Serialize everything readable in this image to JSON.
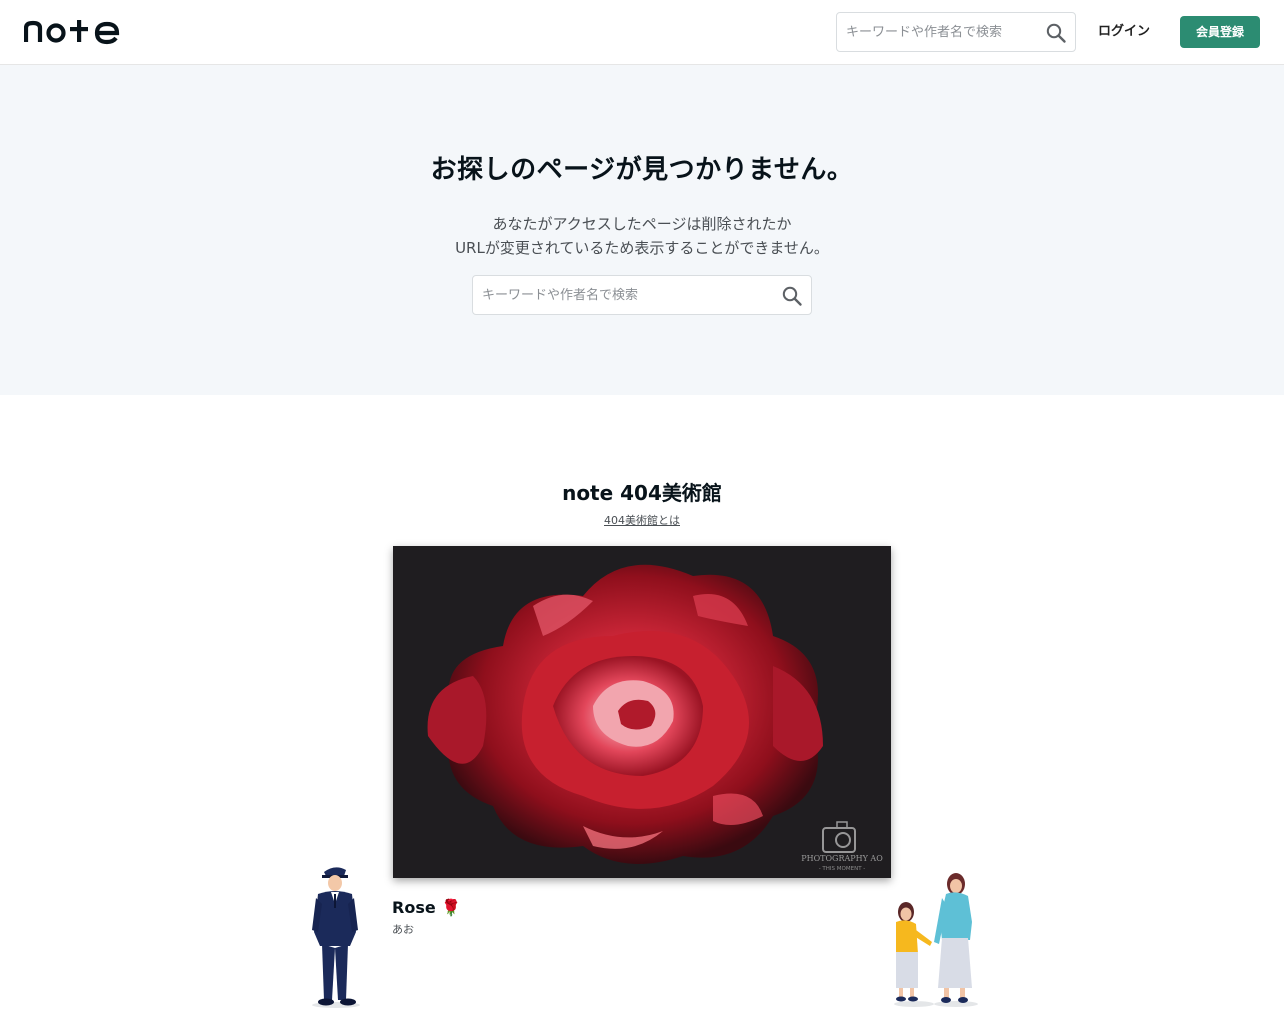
{
  "header": {
    "logo_text": "note",
    "search_placeholder": "キーワードや作者名で検索",
    "login_label": "ログイン",
    "signup_label": "会員登録"
  },
  "hero": {
    "title": "お探しのページが見つかりません。",
    "description_line1": "あなたがアクセスしたページは削除されたか",
    "description_line2": "URLが変更されているため表示することができません。",
    "search_placeholder": "キーワードや作者名で検索"
  },
  "museum": {
    "title": "note 404美術館",
    "about_link": "404美術館とは",
    "artwork_title": "Rose 🌹",
    "artwork_author": "あお",
    "artwork_watermark_line1": "PHOTOGRAPHY AO",
    "artwork_watermark_line2": "- THIS MOMENT -"
  },
  "colors": {
    "accent": "#2c8c72",
    "hero_bg": "#f4f7fa",
    "text": "#08131a"
  }
}
